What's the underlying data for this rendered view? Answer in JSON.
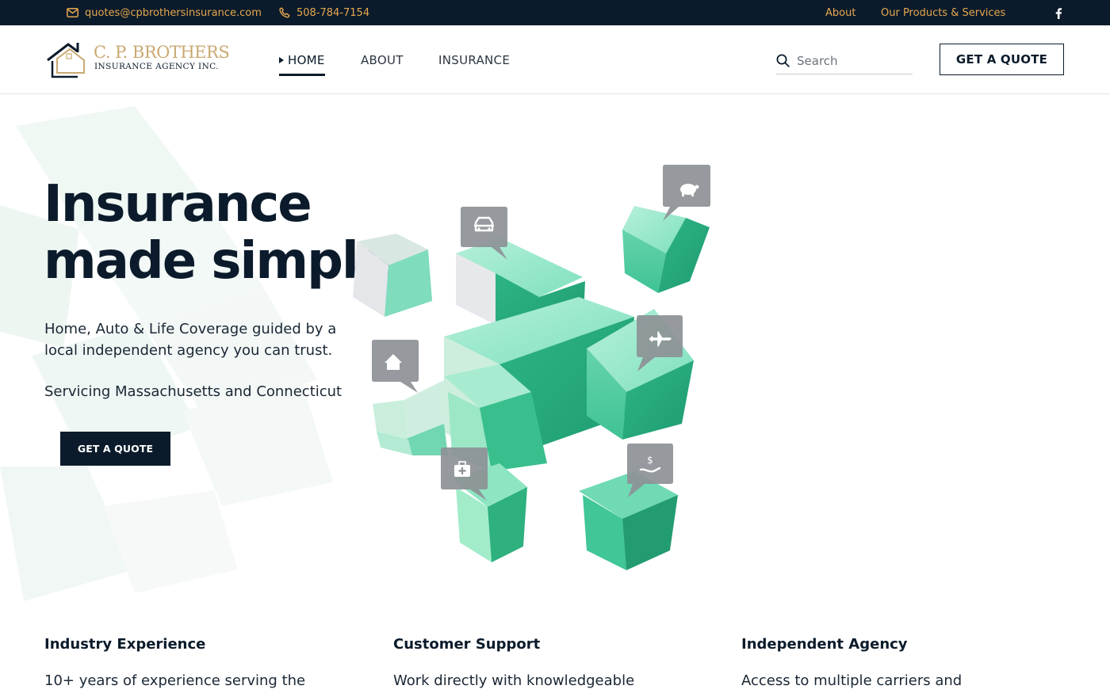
{
  "topbar": {
    "email": "quotes@cpbrothersinsurance.com",
    "phone": "508-784-7154",
    "links": [
      "About",
      "Our Products & Services"
    ],
    "social_icon": "facebook-icon"
  },
  "header": {
    "logo": {
      "brand": "C. P. BROTHERS",
      "sub": "INSURANCE AGENCY INC."
    },
    "nav": [
      "HOME",
      "ABOUT",
      "INSURANCE"
    ],
    "active_nav": "HOME",
    "search_placeholder": "Search",
    "quote_label": "GET A QUOTE"
  },
  "hero": {
    "title_line1": "Insurance",
    "title_line2": "made simple",
    "description": "Home, Auto & Life Coverage guided by a local independent agency you can trust.",
    "service_area": "Servicing Massachusetts and Connecticut",
    "cta_label": "GET A QUOTE",
    "art_icons": [
      "car-icon",
      "piggy-bank-icon",
      "house-icon",
      "airplane-icon",
      "medical-kit-icon",
      "money-hand-icon"
    ]
  },
  "features": [
    {
      "title": "Industry Experience",
      "text": "10+ years of experience serving the"
    },
    {
      "title": "Customer Support",
      "text": "Work directly with knowledgeable"
    },
    {
      "title": "Independent Agency",
      "text": "Access to multiple carriers and"
    }
  ],
  "colors": {
    "navy": "#0b1b2b",
    "accent_orange": "#e6a74f",
    "logo_gold": "#c9a972",
    "teal": "#3cc79a"
  }
}
